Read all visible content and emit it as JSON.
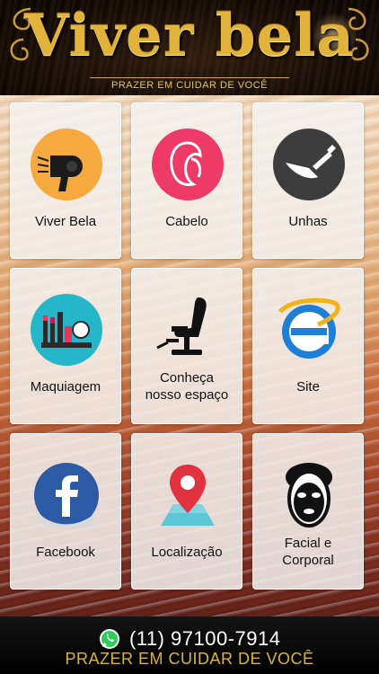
{
  "header": {
    "brand": "Viver bela",
    "tagline": "PRAZER EM CUIDAR DE VOCÊ"
  },
  "menu": [
    {
      "label": "Viver Bela",
      "icon": "hair-dryer-icon",
      "color": "#f5a93f"
    },
    {
      "label": "Cabelo",
      "icon": "woman-hair-icon",
      "color": "#ee3a67"
    },
    {
      "label": "Unhas",
      "icon": "nail-polish-icon",
      "color": "#3d3d3d"
    },
    {
      "label": "Maquiagem",
      "icon": "makeup-icon",
      "color": "#25b7c9"
    },
    {
      "label": "Conheça nosso espaço",
      "line1": "Conheça",
      "line2": "nosso espaço",
      "icon": "salon-chair-icon",
      "color": "#111111"
    },
    {
      "label": "Site",
      "icon": "internet-explorer-icon",
      "color": "#1f7fd6"
    },
    {
      "label": "Facebook",
      "icon": "facebook-icon",
      "color": "#2d5aa5"
    },
    {
      "label": "Localização",
      "icon": "map-pin-icon",
      "color": "#e0323f"
    },
    {
      "label": "Facial e Corporal",
      "line1": "Facial e",
      "line2": "Corporal",
      "icon": "face-mask-icon",
      "color": "#111111"
    }
  ],
  "footer": {
    "phone": "(11) 97100-7914",
    "tagline": "PRAZER EM CUIDAR DE VOCÊ",
    "whatsapp_icon": "whatsapp-icon"
  }
}
